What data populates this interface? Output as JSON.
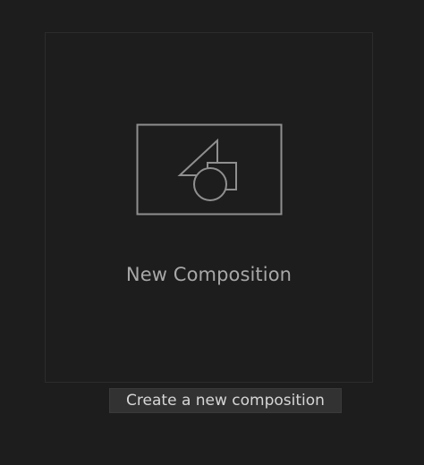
{
  "new_composition": {
    "label": "New Composition",
    "icon": "composition-shapes-icon"
  },
  "tooltip": {
    "text": "Create a new composition"
  }
}
